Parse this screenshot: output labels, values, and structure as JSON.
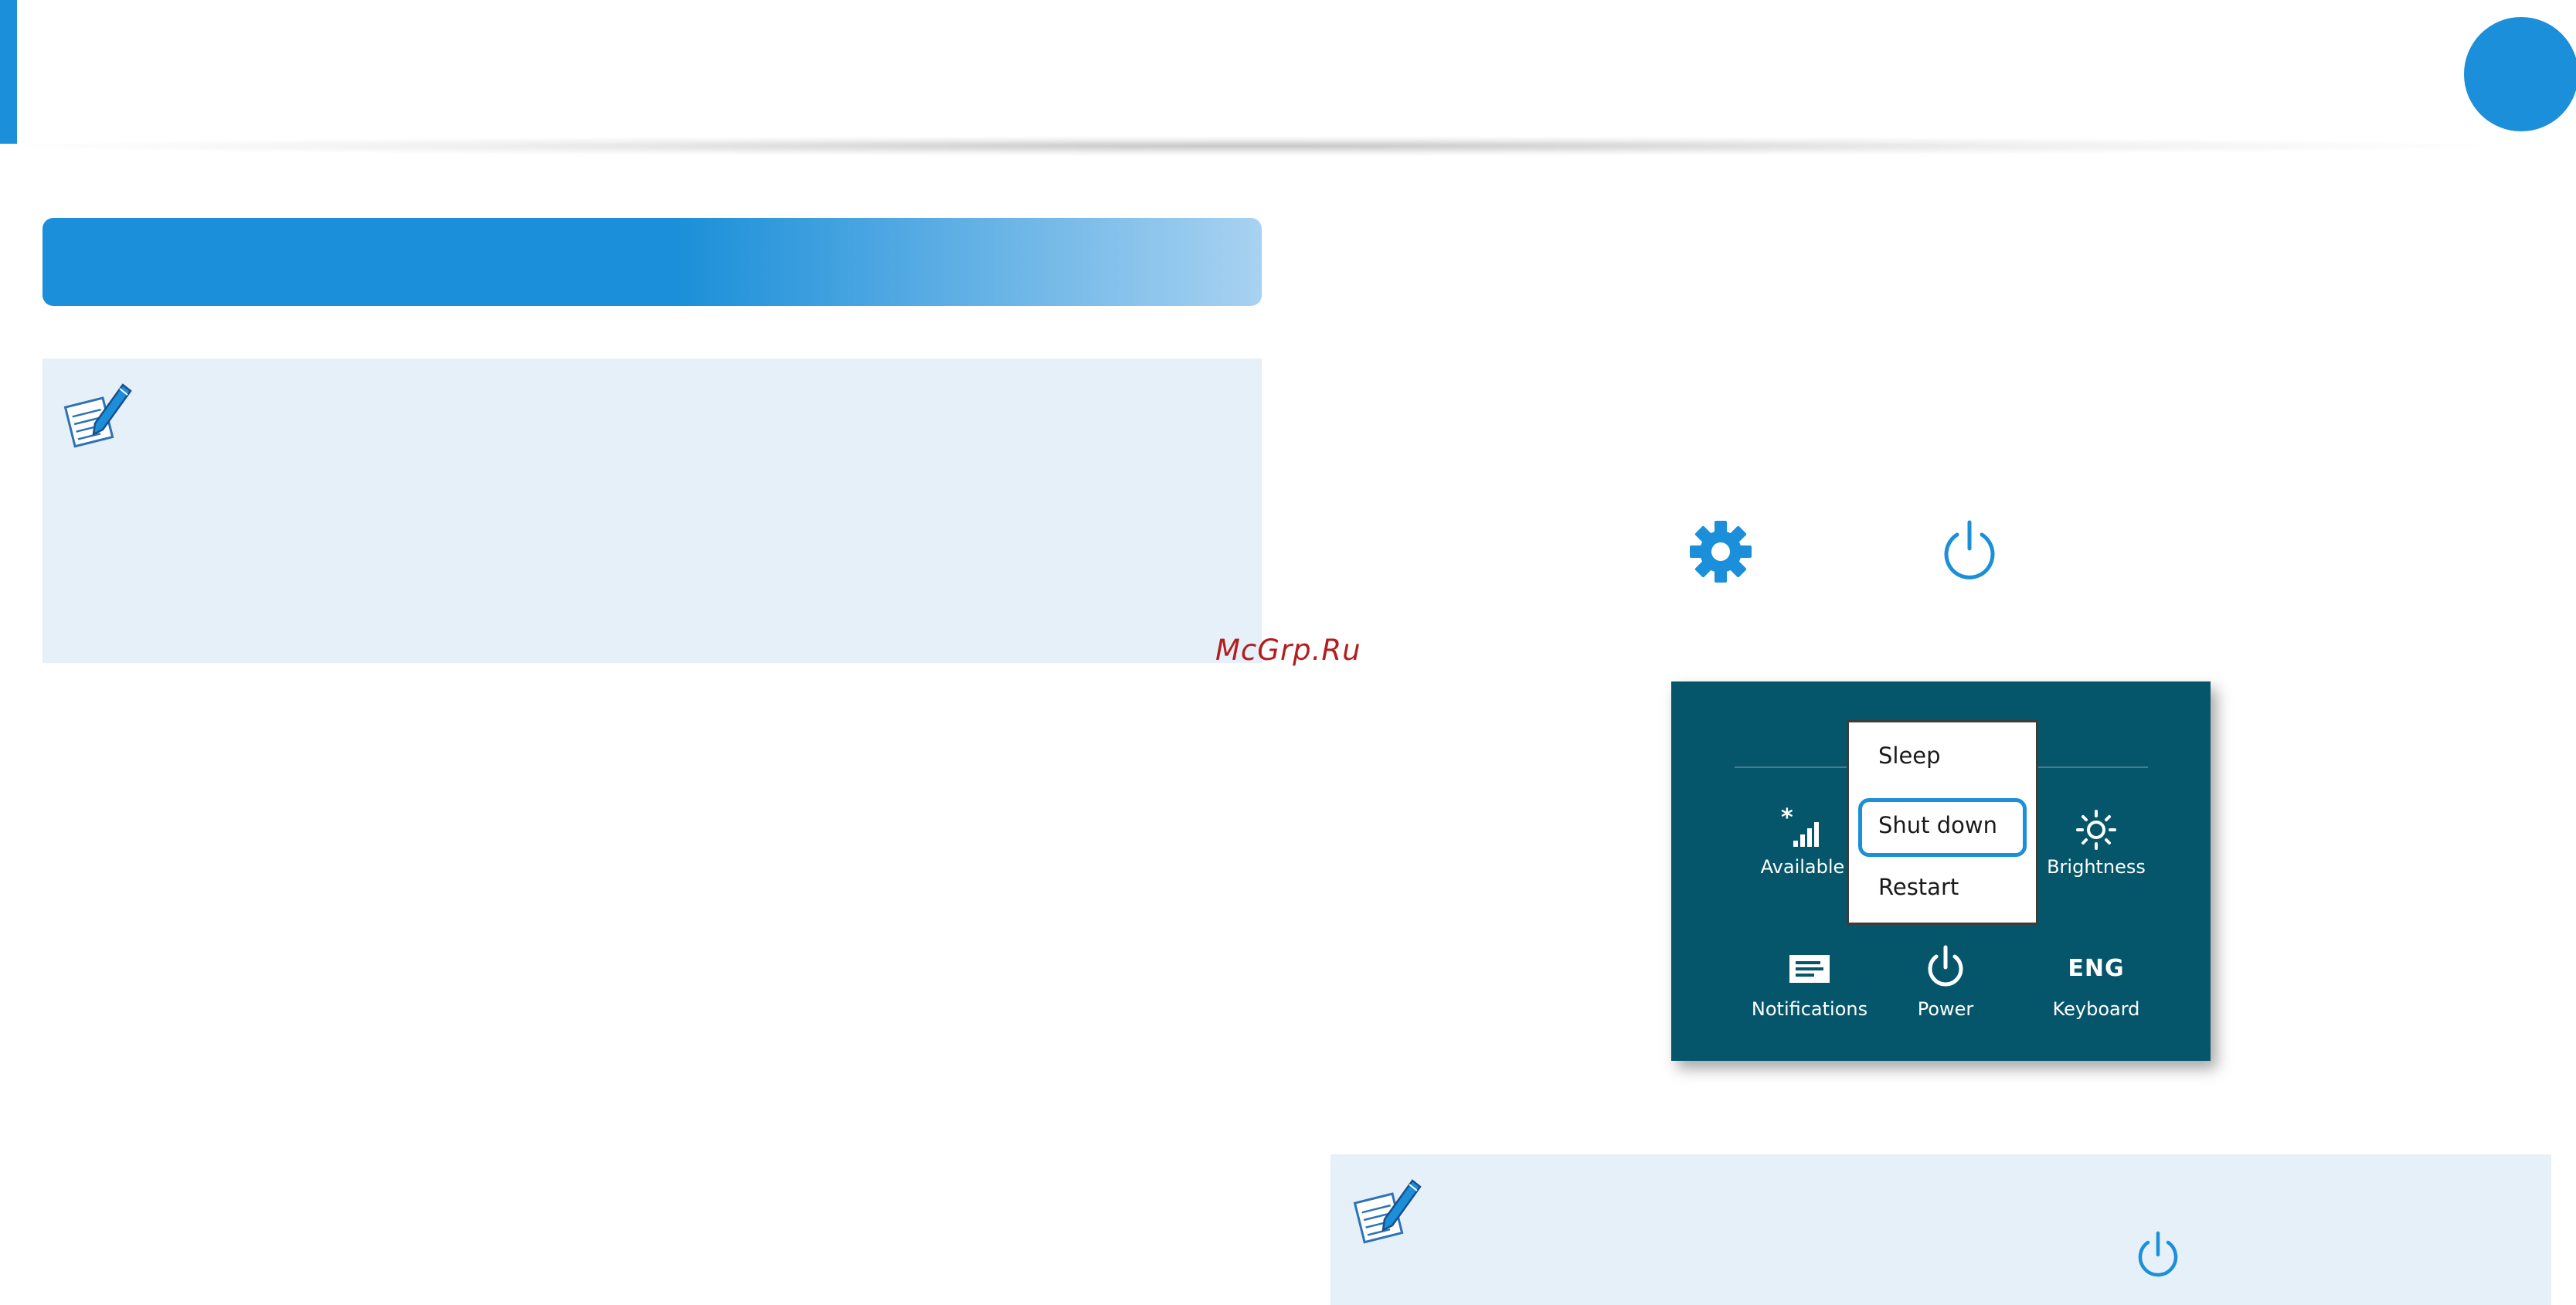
{
  "colors": {
    "accent": "#1b8fd9",
    "note_background": "#e6f0f9",
    "panel_background": "#06566b",
    "watermark": "#b21e1e"
  },
  "watermark": {
    "text": "McGrp.Ru"
  },
  "icons": {
    "note_left": "note-pencil-icon",
    "note_right": "note-pencil-icon",
    "settings": "gear-icon",
    "power": "power-icon",
    "power_note": "power-icon"
  },
  "settings_panel": {
    "power_menu": {
      "items": [
        "Sleep",
        "Shut down",
        "Restart"
      ],
      "highlighted": "Shut down"
    },
    "tiles": [
      {
        "label": "Available",
        "icon": "network-signal-icon"
      },
      {
        "label": "Brightness",
        "icon": "brightness-icon"
      },
      {
        "label": "Notifications",
        "icon": "notifications-icon"
      },
      {
        "label": "Power",
        "icon": "power-icon"
      },
      {
        "label": "Keyboard",
        "icon": "keyboard-icon",
        "glyph_text": "ENG"
      }
    ]
  }
}
